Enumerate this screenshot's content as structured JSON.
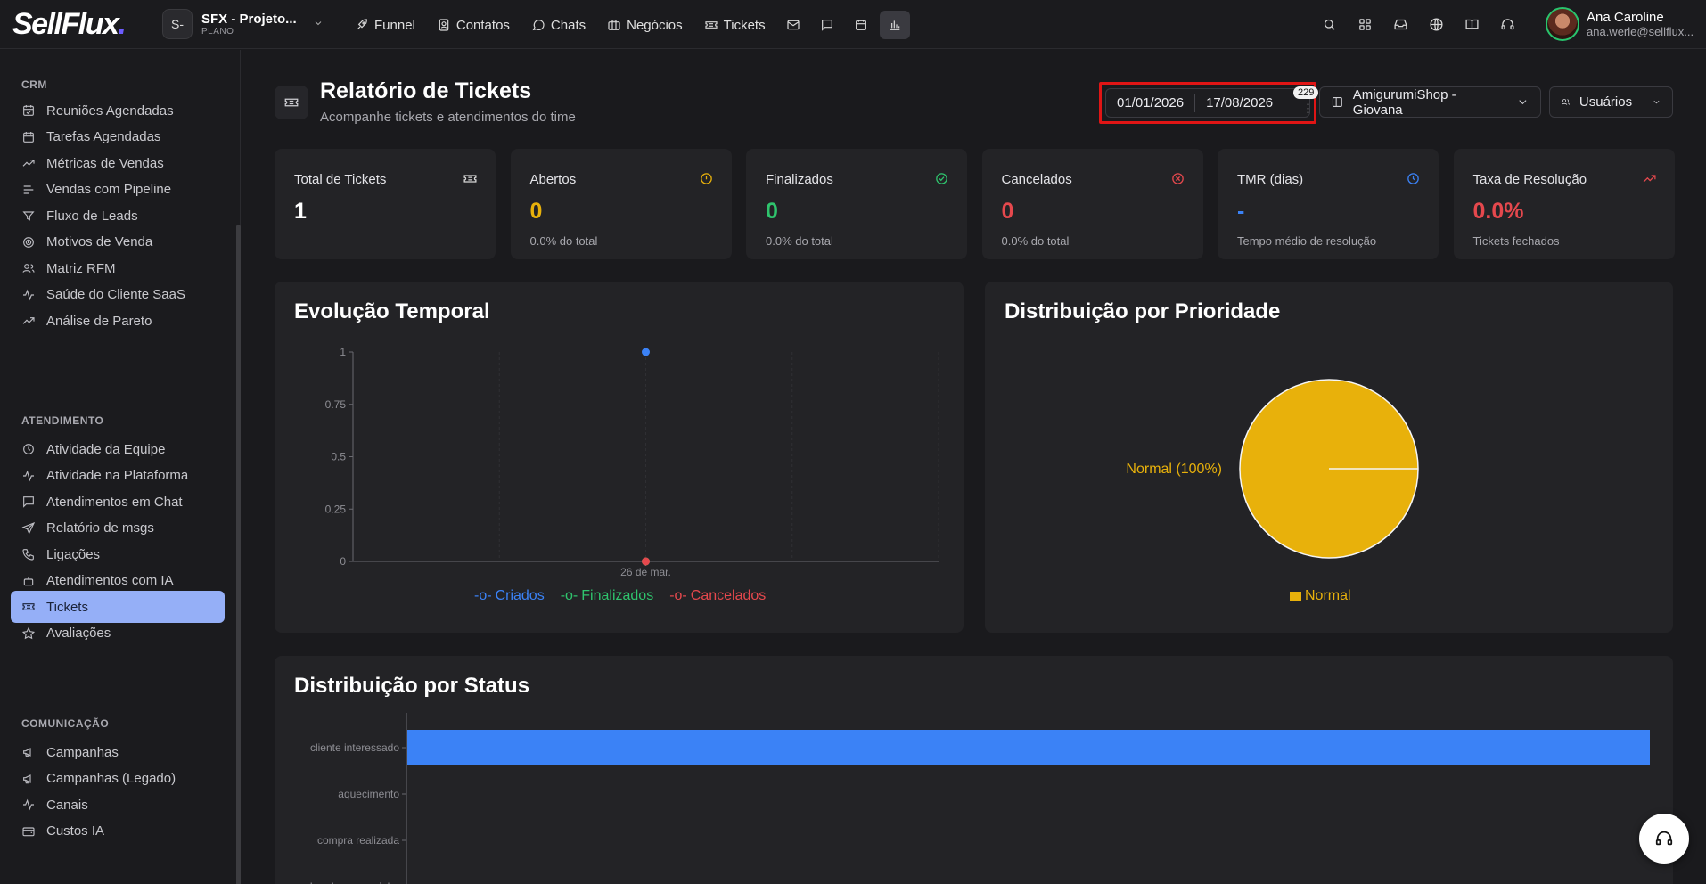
{
  "brand": {
    "logo": "SellFlux",
    "logo_dot": "."
  },
  "project": {
    "avatar": "S-",
    "name": "SFX - Projeto...",
    "plan": "PLANO"
  },
  "nav": {
    "funnel": "Funnel",
    "contatos": "Contatos",
    "chats": "Chats",
    "negocios": "Negócios",
    "tickets": "Tickets"
  },
  "user": {
    "name": "Ana Caroline",
    "email": "ana.werle@sellflux..."
  },
  "sidebar": {
    "crm_title": "CRM",
    "crm": [
      "Reuniões Agendadas",
      "Tarefas Agendadas",
      "Métricas de Vendas",
      "Vendas com Pipeline",
      "Fluxo de Leads",
      "Motivos de Venda",
      "Matriz RFM",
      "Saúde do Cliente SaaS",
      "Análise de Pareto"
    ],
    "atendimento_title": "ATENDIMENTO",
    "atendimento": [
      "Atividade da Equipe",
      "Atividade na Plataforma",
      "Atendimentos em Chat",
      "Relatório de msgs",
      "Ligações",
      "Atendimentos com IA",
      "Tickets",
      "Avaliações"
    ],
    "comunicacao_title": "COMUNICAÇÃO",
    "comunicacao": [
      "Campanhas",
      "Campanhas (Legado)",
      "Canais",
      "Custos IA"
    ]
  },
  "header": {
    "title": "Relatório de Tickets",
    "subtitle": "Acompanhe tickets e atendimentos do time",
    "date_start": "01/01/2026",
    "date_end": "17/08/2026",
    "date_badge": "229",
    "account_select": "AmigurumiShop - Giovana",
    "users_select": "Usuários"
  },
  "cards": [
    {
      "label": "Total de Tickets",
      "value": "1",
      "note": "",
      "color": "#ffffff",
      "icon": "ticket-icon"
    },
    {
      "label": "Abertos",
      "value": "0",
      "note": "0.0% do total",
      "color": "#e8b10b",
      "icon": "alert-circle-icon"
    },
    {
      "label": "Finalizados",
      "value": "0",
      "note": "0.0% do total",
      "color": "#2fc46d",
      "icon": "check-circle-icon"
    },
    {
      "label": "Cancelados",
      "value": "0",
      "note": "0.0% do total",
      "color": "#e5484d",
      "icon": "x-circle-icon"
    },
    {
      "label": "TMR (dias)",
      "value": "-",
      "note": "Tempo médio de resolução",
      "color": "#3b82f6",
      "icon": "clock-icon"
    },
    {
      "label": "Taxa de Resolução",
      "value": "0.0%",
      "note": "Tickets fechados",
      "color": "#e5484d",
      "icon": "trending-up-icon"
    }
  ],
  "colors": {
    "criados": "#3b82f6",
    "finalizados": "#2fc46d",
    "cancelados": "#e5484d",
    "normal": "#e8b10b",
    "status_bar": "#3b82f6"
  },
  "chart_data": [
    {
      "type": "line",
      "title": "Evolução Temporal",
      "x": [
        "26 de mar."
      ],
      "ylim": [
        0,
        1
      ],
      "yticks": [
        "1",
        "0.75",
        "0.5",
        "0.25",
        "0"
      ],
      "series": [
        {
          "name": "Criados",
          "values": [
            1
          ]
        },
        {
          "name": "Finalizados",
          "values": [
            0
          ]
        },
        {
          "name": "Cancelados",
          "values": [
            0
          ]
        }
      ],
      "legend": "bottom",
      "grid": true
    },
    {
      "type": "pie",
      "title": "Distribuição por Prioridade",
      "slices": [
        {
          "name": "Normal",
          "value": 100,
          "label": "Normal (100%)"
        }
      ],
      "legend": "bottom"
    },
    {
      "type": "bar",
      "orientation": "horizontal",
      "title": "Distribuição por Status",
      "categories": [
        "cliente interessado",
        "aquecimento",
        "compra realizada",
        "abandonou carrinho"
      ],
      "values": [
        1,
        0,
        0,
        0
      ]
    }
  ]
}
